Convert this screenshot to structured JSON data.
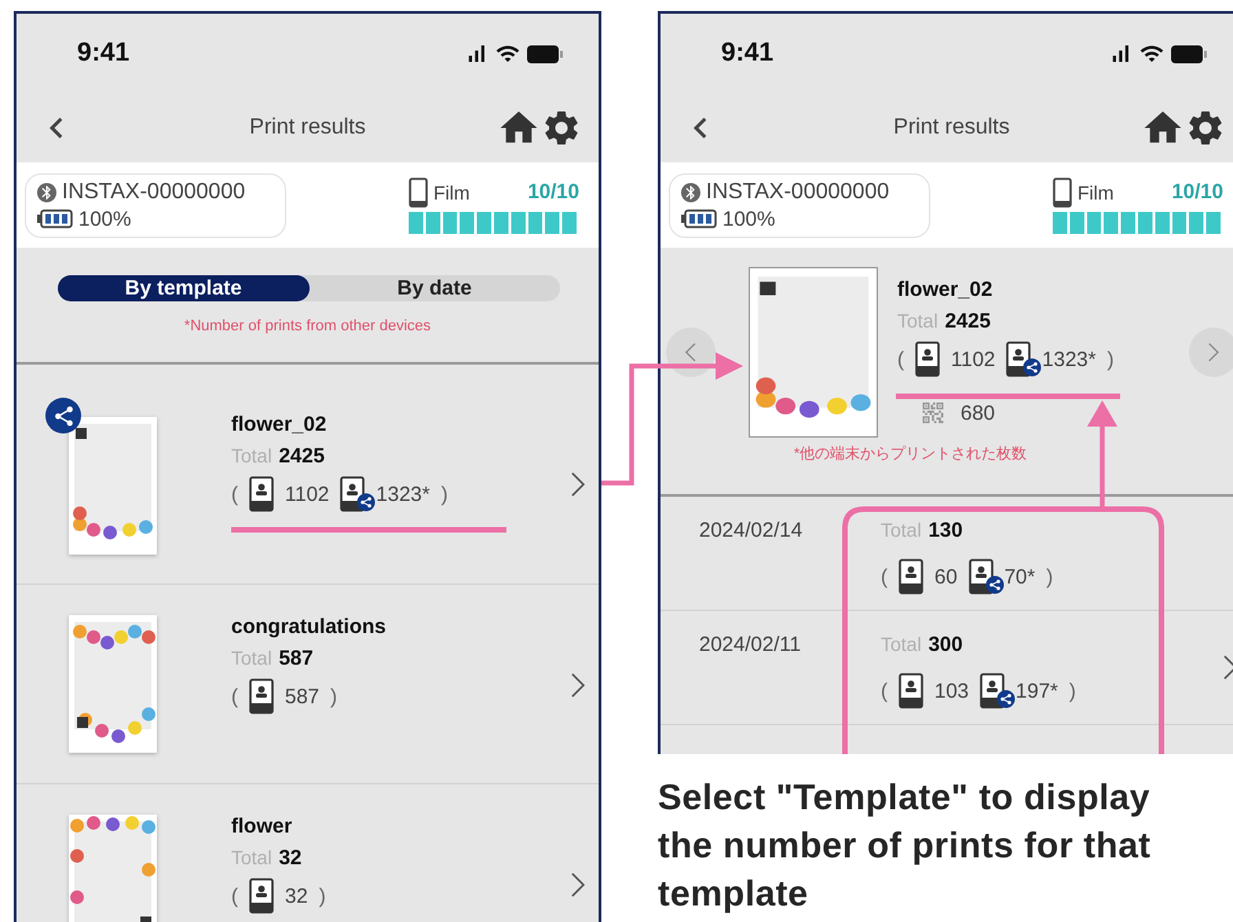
{
  "phones": [
    {
      "time": "9:41",
      "title": "Print results",
      "printer": {
        "name": "INSTAX-00000000",
        "battery": "100%"
      },
      "film": {
        "label": "Film",
        "count": "10/10",
        "level": 1
      },
      "view": {
        "kind": "list",
        "tabs": [
          {
            "label": "By template",
            "selected": true
          },
          {
            "label": "By date",
            "selected": false
          }
        ],
        "note": "*Number of prints from other devices",
        "templates": [
          {
            "name": "flower_02",
            "total_label": "Total",
            "total": "2425",
            "counts": {
              "open": "(",
              "own": "1102",
              "other": "1323*",
              "close": ")"
            },
            "shared": true
          },
          {
            "name": "congratulations",
            "total_label": "Total",
            "total": "587",
            "counts": {
              "open": "(",
              "own": "587",
              "close": ")"
            },
            "shared": false
          },
          {
            "name": "flower",
            "total_label": "Total",
            "total": "32",
            "counts": {
              "open": "(",
              "own": "32",
              "close": ")"
            },
            "shared": false
          }
        ]
      }
    },
    {
      "time": "9:41",
      "title": "Print results",
      "printer": {
        "name": "INSTAX-00000000",
        "battery": "100%"
      },
      "film": {
        "label": "Film",
        "count": "10/10",
        "level": 1
      },
      "view": {
        "kind": "detail",
        "template": {
          "name": "flower_02",
          "total_label": "Total",
          "total": "2425",
          "counts": {
            "open": "(",
            "own": "1102",
            "other": "1323*",
            "close": ")"
          },
          "qr": "680"
        },
        "note": "*他の端末からプリントされた枚数",
        "dates": [
          {
            "date": "2024/02/14",
            "total_label": "Total",
            "total": "130",
            "counts": {
              "open": "(",
              "own": "60",
              "other": "70*",
              "close": ")"
            },
            "chevron": false
          },
          {
            "date": "2024/02/11",
            "total_label": "Total",
            "total": "300",
            "counts": {
              "open": "(",
              "own": "103",
              "other": "197*",
              "close": ")"
            },
            "chevron": true
          }
        ]
      }
    }
  ],
  "caption": "Select \"Template\" to display the number of prints for that template"
}
